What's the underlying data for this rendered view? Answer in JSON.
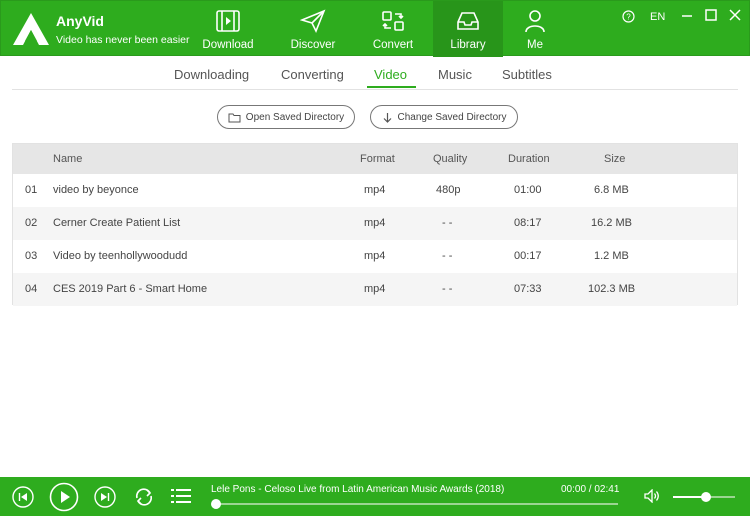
{
  "app": {
    "name": "AnyVid",
    "slogan": "Video has never been easier"
  },
  "nav": [
    {
      "label": "Download",
      "icon": "download-icon"
    },
    {
      "label": "Discover",
      "icon": "paper-plane-icon"
    },
    {
      "label": "Convert",
      "icon": "convert-icon"
    },
    {
      "label": "Library",
      "icon": "inbox-icon",
      "active": true
    },
    {
      "label": "Me",
      "icon": "user-icon"
    }
  ],
  "window": {
    "help": "?",
    "lang": "EN"
  },
  "tabs": [
    "Downloading",
    "Converting",
    "Video",
    "Music",
    "Subtitles"
  ],
  "active_tab": "Video",
  "buttons": {
    "open_dir": "Open Saved Directory",
    "change_dir": "Change Saved Directory"
  },
  "table": {
    "headers": {
      "name": "Name",
      "format": "Format",
      "quality": "Quality",
      "duration": "Duration",
      "size": "Size"
    },
    "rows": [
      {
        "num": "01",
        "name": "video by beyonce",
        "format": "mp4",
        "quality": "480p",
        "duration": "01:00",
        "size": "6.8 MB"
      },
      {
        "num": "02",
        "name": "Cerner Create Patient List",
        "format": "mp4",
        "quality": "- -",
        "duration": "08:17",
        "size": "16.2 MB"
      },
      {
        "num": "03",
        "name": "Video by teenhollywoodudd",
        "format": "mp4",
        "quality": "- -",
        "duration": "00:17",
        "size": "1.2 MB"
      },
      {
        "num": "04",
        "name": "CES 2019 Part 6 - Smart Home",
        "format": "mp4",
        "quality": "- -",
        "duration": "07:33",
        "size": "102.3 MB"
      }
    ]
  },
  "player": {
    "track_title": "Lele Pons - Celoso Live from Latin American Music Awards (2018)",
    "time": "00:00 / 02:41",
    "progress": 0.0,
    "volume": 0.53
  },
  "colors": {
    "accent": "#2eac1e",
    "accent_dark": "#28951a"
  }
}
